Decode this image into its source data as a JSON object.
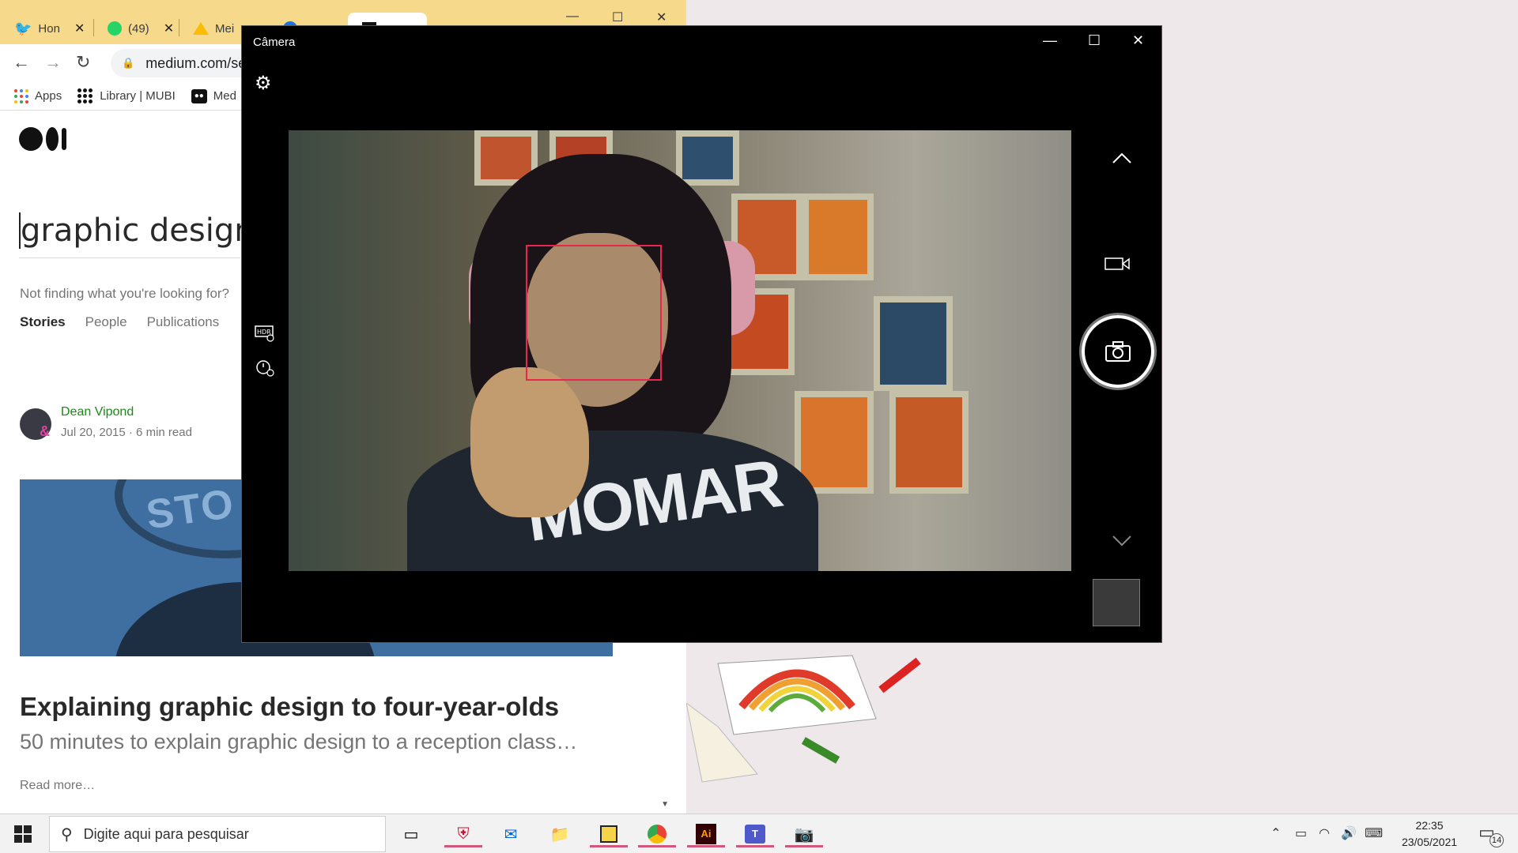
{
  "browser": {
    "tabs": [
      {
        "label": "Hon",
        "icon": "twitter-icon",
        "color": "#1da1f2"
      },
      {
        "label": "(49)",
        "icon": "whatsapp-icon",
        "color": "#25d366"
      },
      {
        "label": "Mei",
        "icon": "drive-icon",
        "color": "#fbbc04"
      },
      {
        "label": "",
        "icon": "tab-icon",
        "color": "#1a73e8"
      },
      {
        "label": "",
        "icon": "medium-tab-icon",
        "color": "#000000"
      }
    ],
    "url": "medium.com/se",
    "bookmarks": [
      {
        "label": "Apps"
      },
      {
        "label": "Library | MUBI"
      },
      {
        "label": "Med"
      }
    ]
  },
  "page": {
    "search_query": "graphic design",
    "not_finding": "Not finding what you're looking for?",
    "tabs": [
      "Stories",
      "People",
      "Publications"
    ],
    "active_tab": "Stories",
    "story": {
      "author": "Dean Vipond",
      "meta": "Jul 20, 2015 · 6 min read",
      "hero_text": "STO",
      "title": "Explaining graphic design to four-year-olds",
      "subtitle": "50 minutes to explain graphic design to a reception class…",
      "read_more": "Read more…"
    }
  },
  "camera": {
    "title": "Câmera",
    "shirt_text": "MOMAR",
    "face_box_color": "#e8264e"
  },
  "taskbar": {
    "search_placeholder": "Digite aqui para pesquisar",
    "time": "22:35",
    "date": "23/05/2021",
    "notifications": "14"
  },
  "colors": {
    "chrome_tabbar": "#f7d98b",
    "medium_green": "#1a8917",
    "taskbar_highlight": "#d0587a"
  }
}
